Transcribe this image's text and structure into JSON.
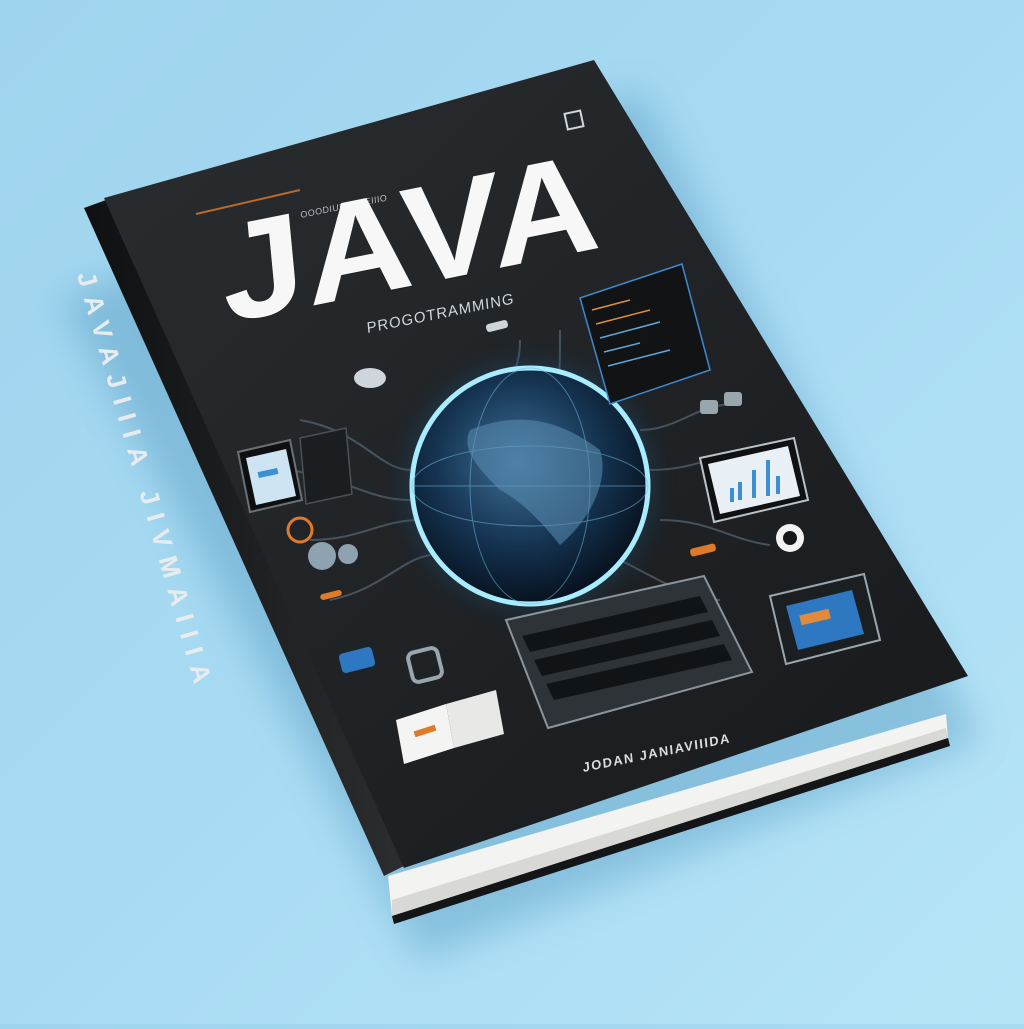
{
  "book": {
    "title": "JAVA",
    "subtitle": "PROGOTRAMMING",
    "author": "JODAN JANIAVIIIDA",
    "tagline": "OOODIUNIIIIDEIIIO",
    "spine_text": "JAVAJIIIA JIVMAIIIA"
  },
  "colors": {
    "background": "#a7daf2",
    "cover": "#1e2124",
    "accent_glow": "#5fc8ff",
    "accent_orange": "#e07a2a"
  }
}
